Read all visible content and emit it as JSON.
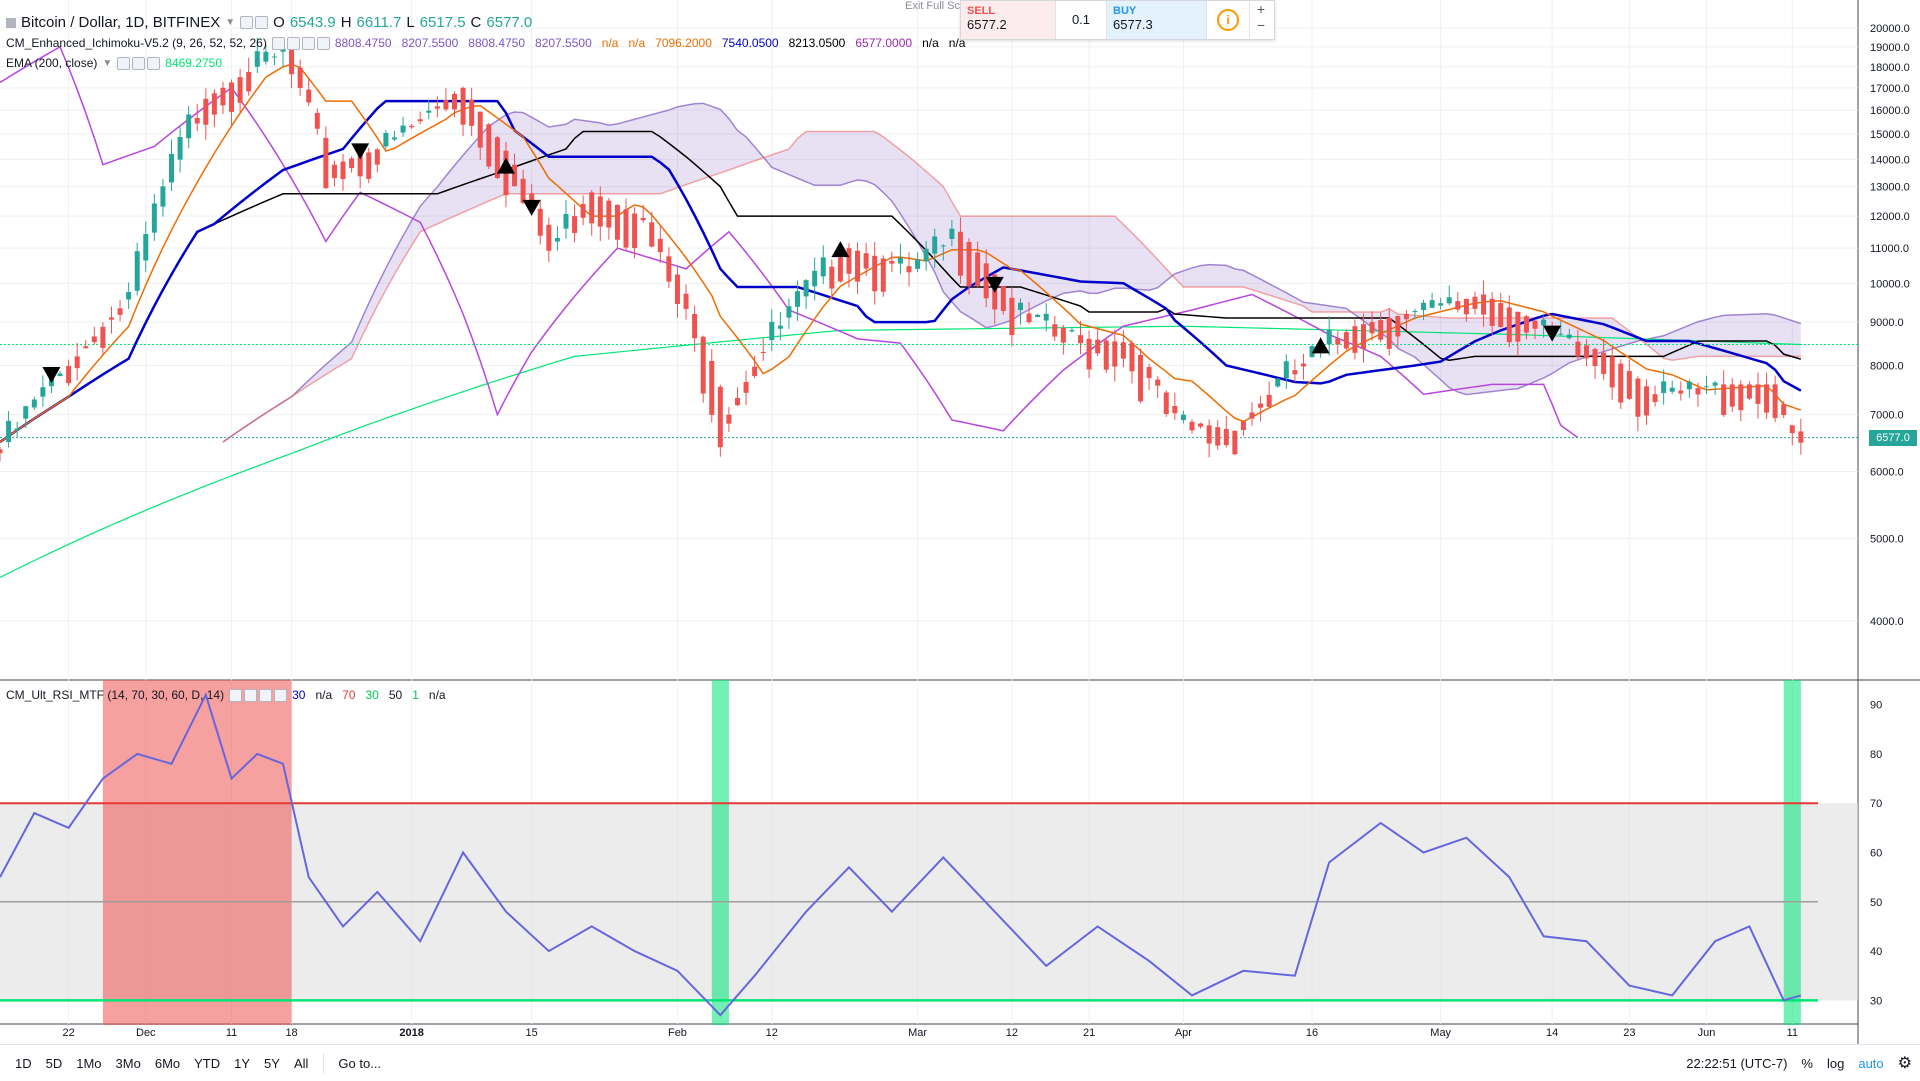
{
  "header": {
    "symbol": "Bitcoin / Dollar, 1D, BITFINEX",
    "open_label": "O",
    "open": "6543.9",
    "high_label": "H",
    "high": "6611.7",
    "low_label": "L",
    "low": "6517.5",
    "close_label": "C",
    "close": "6577.0"
  },
  "indicators": {
    "ichimoku": {
      "name": "CM_Enhanced_Ichimoku-V5.2 (9, 26, 52, 52, 26)",
      "values": [
        {
          "text": "8808.4750",
          "color": "#7e57c2"
        },
        {
          "text": "8207.5500",
          "color": "#7e57c2"
        },
        {
          "text": "8808.4750",
          "color": "#7e57c2"
        },
        {
          "text": "8207.5500",
          "color": "#7e57c2"
        },
        {
          "text": "n/a",
          "color": "#ef6c00"
        },
        {
          "text": "n/a",
          "color": "#ef6c00"
        },
        {
          "text": "7096.2000",
          "color": "#ef6c00"
        },
        {
          "text": "7540.0500",
          "color": "#0000cc"
        },
        {
          "text": "8213.0500",
          "color": "#000000"
        },
        {
          "text": "6577.0000",
          "color": "#9c27b0"
        },
        {
          "text": "n/a",
          "color": "#000000"
        },
        {
          "text": "n/a",
          "color": "#000000"
        }
      ]
    },
    "ema": {
      "name": "EMA (200, close)",
      "value": "8469.2750",
      "value_color": "#00e676"
    },
    "rsi": {
      "name": "CM_Ult_RSI_MTF (14, 70, 30, 60, D, 14)",
      "values": [
        {
          "text": "30",
          "color": "#0000cc"
        },
        {
          "text": "n/a",
          "color": "#131722"
        },
        {
          "text": "70",
          "color": "#e53935"
        },
        {
          "text": "30",
          "color": "#00c853"
        },
        {
          "text": "50",
          "color": "#131722"
        },
        {
          "text": "1",
          "color": "#00c853"
        },
        {
          "text": "n/a",
          "color": "#131722"
        }
      ]
    }
  },
  "trade": {
    "exit_label": "Exit Full Sc",
    "sell_label": "SELL",
    "sell_price": "6577.2",
    "quantity": "0.1",
    "buy_label": "BUY",
    "buy_price": "6577.3",
    "plus": "+",
    "minus": "−"
  },
  "price_tag": "6577.0",
  "bottom": {
    "timeframes": [
      "1D",
      "5D",
      "1Mo",
      "3Mo",
      "6Mo",
      "YTD",
      "1Y",
      "5Y",
      "All"
    ],
    "goto": "Go to...",
    "time": "22:22:51 (UTC-7)",
    "percent": "%",
    "log": "log",
    "auto": "auto"
  },
  "colors": {
    "up": "#26a69a",
    "down": "#ef5350",
    "tenkan": "#ef6c00",
    "kijun": "#0000cc",
    "black_line": "#000000",
    "chikou": "#b845e0",
    "ema": "#00e676",
    "cloud_bull": "#7e57c2",
    "cloud_bear": "#ef5350",
    "rsi": "#6666dd"
  },
  "chart_data": [
    {
      "type": "candlestick",
      "title": "Bitcoin / Dollar, 1D, BITFINEX",
      "log_scale": true,
      "y_ticks": [
        "20000.0",
        "19000.0",
        "18000.0",
        "17000.0",
        "16000.0",
        "15000.0",
        "14000.0",
        "13000.0",
        "12000.0",
        "11000.0",
        "10000.0",
        "9000.0",
        "8000.0",
        "7000.0",
        "6000.0",
        "5000.0",
        "4000.0"
      ],
      "x_ticks": [
        "22",
        "Dec",
        "11",
        "18",
        "2018",
        "15",
        "Feb",
        "12",
        "Mar",
        "12",
        "21",
        "Apr",
        "16",
        "May",
        "14",
        "23",
        "Jun",
        "11"
      ],
      "ylim": [
        3500,
        21000
      ],
      "close_series": [
        {
          "date": "2017-11-14",
          "close": 6500
        },
        {
          "date": "2017-11-22",
          "close": 8200
        },
        {
          "date": "2017-11-29",
          "close": 9800
        },
        {
          "date": "2017-12-07",
          "close": 16500
        },
        {
          "date": "2017-12-17",
          "close": 19000
        },
        {
          "date": "2017-12-22",
          "close": 13800
        },
        {
          "date": "2017-12-28",
          "close": 14500
        },
        {
          "date": "2018-01-06",
          "close": 17000
        },
        {
          "date": "2018-01-12",
          "close": 13800
        },
        {
          "date": "2018-01-17",
          "close": 11200
        },
        {
          "date": "2018-01-21",
          "close": 12800
        },
        {
          "date": "2018-01-28",
          "close": 11800
        },
        {
          "date": "2018-02-02",
          "close": 9200
        },
        {
          "date": "2018-02-06",
          "close": 7000
        },
        {
          "date": "2018-02-10",
          "close": 8300
        },
        {
          "date": "2018-02-20",
          "close": 11000
        },
        {
          "date": "2018-02-28",
          "close": 10400
        },
        {
          "date": "2018-03-05",
          "close": 11500
        },
        {
          "date": "2018-03-12",
          "close": 9300
        },
        {
          "date": "2018-03-20",
          "close": 8600
        },
        {
          "date": "2018-03-25",
          "close": 8500
        },
        {
          "date": "2018-03-31",
          "close": 6900
        },
        {
          "date": "2018-04-06",
          "close": 6700
        },
        {
          "date": "2018-04-13",
          "close": 7900
        },
        {
          "date": "2018-04-20",
          "close": 8900
        },
        {
          "date": "2018-04-28",
          "close": 9300
        },
        {
          "date": "2018-05-05",
          "close": 9700
        },
        {
          "date": "2018-05-14",
          "close": 8700
        },
        {
          "date": "2018-05-20",
          "close": 8200
        },
        {
          "date": "2018-05-25",
          "close": 7400
        },
        {
          "date": "2018-06-02",
          "close": 7600
        },
        {
          "date": "2018-06-08",
          "close": 7600
        },
        {
          "date": "2018-06-10",
          "close": 6800
        },
        {
          "date": "2018-06-12",
          "close": 6577
        }
      ],
      "signals": [
        {
          "date": "2017-11-20",
          "dir": "down"
        },
        {
          "date": "2017-12-26",
          "dir": "down"
        },
        {
          "date": "2018-01-12",
          "dir": "up"
        },
        {
          "date": "2018-01-15",
          "dir": "down"
        },
        {
          "date": "2018-02-20",
          "dir": "up"
        },
        {
          "date": "2018-03-10",
          "dir": "down"
        },
        {
          "date": "2018-04-17",
          "dir": "up"
        },
        {
          "date": "2018-05-14",
          "dir": "down"
        }
      ],
      "ema_200": [
        {
          "date": "2017-11-14",
          "value": 4500
        },
        {
          "date": "2017-12-18",
          "value": 6300
        },
        {
          "date": "2018-01-20",
          "value": 8200
        },
        {
          "date": "2018-02-20",
          "value": 8800
        },
        {
          "date": "2018-04-01",
          "value": 8900
        },
        {
          "date": "2018-05-10",
          "value": 8700
        },
        {
          "date": "2018-06-12",
          "value": 8469.275
        }
      ]
    },
    {
      "type": "line",
      "title": "CM_Ult_RSI_MTF (14, 70, 30, 60, D, 14)",
      "ylim": [
        25,
        95
      ],
      "y_ticks": [
        "90",
        "80",
        "70",
        "60",
        "50",
        "40",
        "30"
      ],
      "levels": {
        "upper": 70,
        "mid": 50,
        "lower": 30
      },
      "highlight_zones": [
        {
          "from": "2017-11-26",
          "to": "2017-12-18",
          "color": "#ef5350"
        },
        {
          "from": "2018-02-05",
          "to": "2018-02-07",
          "color": "#00e676"
        },
        {
          "from": "2018-06-10",
          "to": "2018-06-12",
          "color": "#00e676"
        }
      ],
      "series": [
        {
          "values": [
            {
              "date": "2017-11-14",
              "value": 55
            },
            {
              "date": "2017-11-18",
              "value": 68
            },
            {
              "date": "2017-11-22",
              "value": 65
            },
            {
              "date": "2017-11-26",
              "value": 75
            },
            {
              "date": "2017-11-30",
              "value": 80
            },
            {
              "date": "2017-12-04",
              "value": 78
            },
            {
              "date": "2017-12-08",
              "value": 92
            },
            {
              "date": "2017-12-11",
              "value": 75
            },
            {
              "date": "2017-12-14",
              "value": 80
            },
            {
              "date": "2017-12-17",
              "value": 78
            },
            {
              "date": "2017-12-20",
              "value": 55
            },
            {
              "date": "2017-12-24",
              "value": 45
            },
            {
              "date": "2017-12-28",
              "value": 52
            },
            {
              "date": "2018-01-02",
              "value": 42
            },
            {
              "date": "2018-01-07",
              "value": 60
            },
            {
              "date": "2018-01-12",
              "value": 48
            },
            {
              "date": "2018-01-17",
              "value": 40
            },
            {
              "date": "2018-01-22",
              "value": 45
            },
            {
              "date": "2018-01-27",
              "value": 40
            },
            {
              "date": "2018-02-01",
              "value": 36
            },
            {
              "date": "2018-02-06",
              "value": 27
            },
            {
              "date": "2018-02-10",
              "value": 35
            },
            {
              "date": "2018-02-16",
              "value": 48
            },
            {
              "date": "2018-02-21",
              "value": 57
            },
            {
              "date": "2018-02-26",
              "value": 48
            },
            {
              "date": "2018-03-04",
              "value": 59
            },
            {
              "date": "2018-03-10",
              "value": 48
            },
            {
              "date": "2018-03-16",
              "value": 37
            },
            {
              "date": "2018-03-22",
              "value": 45
            },
            {
              "date": "2018-03-28",
              "value": 38
            },
            {
              "date": "2018-04-02",
              "value": 31
            },
            {
              "date": "2018-04-08",
              "value": 36
            },
            {
              "date": "2018-04-14",
              "value": 35
            },
            {
              "date": "2018-04-18",
              "value": 58
            },
            {
              "date": "2018-04-24",
              "value": 66
            },
            {
              "date": "2018-04-29",
              "value": 60
            },
            {
              "date": "2018-05-04",
              "value": 63
            },
            {
              "date": "2018-05-09",
              "value": 55
            },
            {
              "date": "2018-05-13",
              "value": 43
            },
            {
              "date": "2018-05-18",
              "value": 42
            },
            {
              "date": "2018-05-23",
              "value": 33
            },
            {
              "date": "2018-05-28",
              "value": 31
            },
            {
              "date": "2018-06-02",
              "value": 42
            },
            {
              "date": "2018-06-06",
              "value": 45
            },
            {
              "date": "2018-06-10",
              "value": 30
            },
            {
              "date": "2018-06-12",
              "value": 31
            }
          ]
        }
      ]
    }
  ]
}
